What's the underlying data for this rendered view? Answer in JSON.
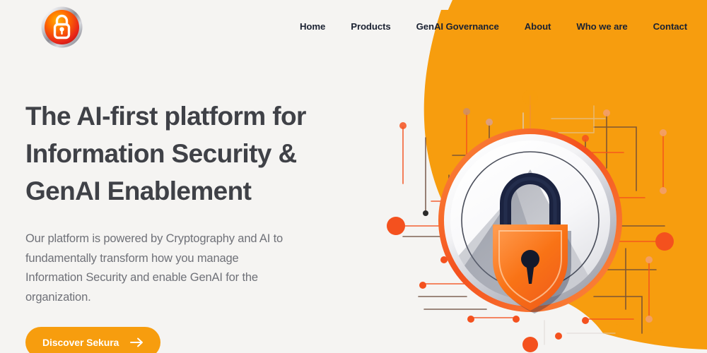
{
  "page": {
    "background_color": "#f5f4f2",
    "brand_orange": "#f79d0e",
    "accent_red_orange": "#f4511e",
    "heading_color": "#3f4147",
    "body_color": "#6f7178",
    "nav_text_color": "#1b2232"
  },
  "header": {
    "logo": {
      "icon": "padlock-badge-logo",
      "alt": "Sekura logo"
    },
    "nav_items": [
      {
        "label": "Home",
        "name": "nav-home"
      },
      {
        "label": "Products",
        "name": "nav-products"
      },
      {
        "label": "GenAI Governance",
        "name": "nav-genai-governance"
      },
      {
        "label": "About",
        "name": "nav-about"
      },
      {
        "label": "Who we are",
        "name": "nav-who-we-are"
      },
      {
        "label": "Contact",
        "name": "nav-contact"
      }
    ]
  },
  "hero": {
    "title_line_1": "The AI-first platform for",
    "title_line_2": "Information Security &",
    "title_line_3": "GenAI Enablement",
    "subtitle": "Our platform is powered by Cryptography and AI to fundamentally transform how you manage Information Security and enable GenAI for the organization.",
    "cta": {
      "label": "Discover Sekura",
      "icon": "arrow-right-icon"
    },
    "illustration": {
      "name": "security-lock-circuit-illustration",
      "description": "Circular metallic badge with orange shield padlock over a circuit-board pattern"
    }
  }
}
